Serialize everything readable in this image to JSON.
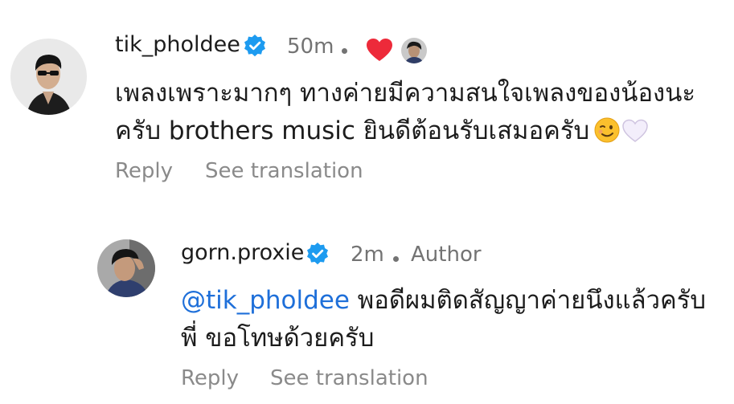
{
  "comment1": {
    "username": "tik_pholdee",
    "time": "50m",
    "text_line1": "เพลงเพราะมากๆ ทางค่ายมีความสนใจเพลงของน้องนะ",
    "text_line2": "ครับ brothers music ยินดีต้อนรับเสมอครับ",
    "reply_label": "Reply",
    "translate_label": "See translation",
    "liked_by_author": true
  },
  "comment2": {
    "username": "gorn.proxie",
    "time": "2m",
    "author_badge": "Author",
    "mention": "@tik_pholdee",
    "text_line1": " พอดีผมติดสัญญาค่ายนึงแล้วครับ",
    "text_line2": "พี่ ขอโทษด้วยครับ",
    "reply_label": "Reply",
    "translate_label": "See translation"
  },
  "colors": {
    "verified": "#1d9bf0",
    "heart": "#ed2a3a",
    "mention": "#1e6fd9",
    "secondary_text": "#737373"
  },
  "icons": [
    "verified-badge-icon",
    "heart-icon",
    "wink-emoji",
    "white-heart-emoji"
  ]
}
